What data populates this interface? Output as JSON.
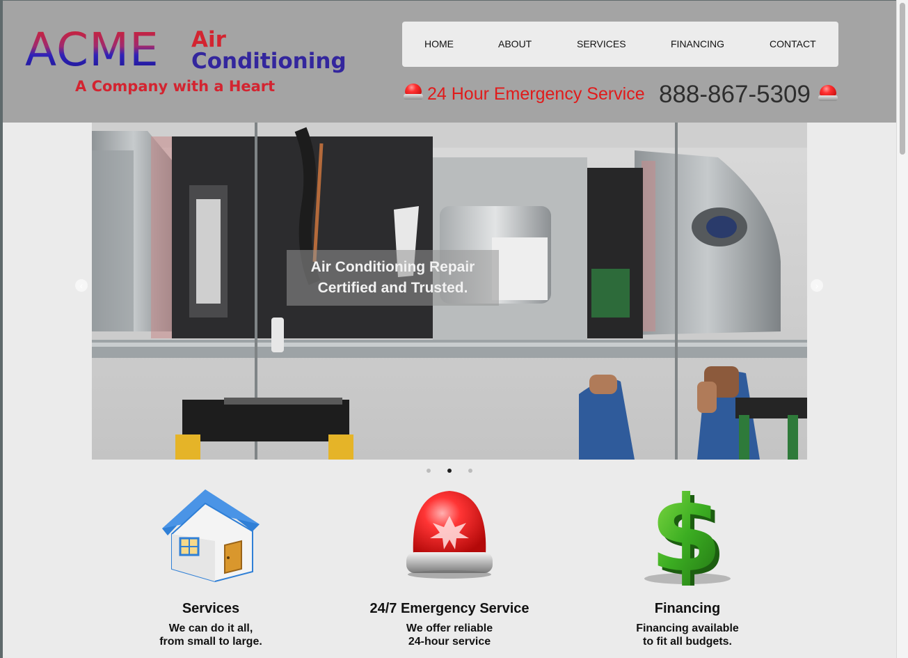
{
  "brand": {
    "name": "ACME",
    "air": "Air",
    "conditioning": "Conditioning",
    "tagline": "A Company with a Heart",
    "colors": {
      "red": "#d32430",
      "blue": "#2f23b8",
      "header_bg": "#a4a4a4"
    }
  },
  "nav": {
    "items": [
      {
        "label": "HOME"
      },
      {
        "label": "ABOUT"
      },
      {
        "label": "SERVICES"
      },
      {
        "label": "FINANCING"
      },
      {
        "label": "CONTACT"
      }
    ]
  },
  "contact": {
    "emergency_text": "24 Hour Emergency Service",
    "phone": "888-867-5309",
    "icon": "red-beacon-icon"
  },
  "slider": {
    "caption_line1": "Air Conditioning Repair",
    "caption_line2": "Certified and Trusted.",
    "prev_icon": "chevron-left-icon",
    "next_icon": "chevron-right-icon",
    "slide_count": 3,
    "active_slide": 2
  },
  "features": [
    {
      "icon": "house-icon",
      "title": "Services",
      "line1": "We can do it all,",
      "line2": "from small to large."
    },
    {
      "icon": "red-beacon-icon",
      "title": "24/7 Emergency Service",
      "line1": "We offer reliable",
      "line2": "24-hour service"
    },
    {
      "icon": "dollar-sign-icon",
      "title": "Financing",
      "line1": "Financing available",
      "line2": "to fit all budgets."
    }
  ]
}
